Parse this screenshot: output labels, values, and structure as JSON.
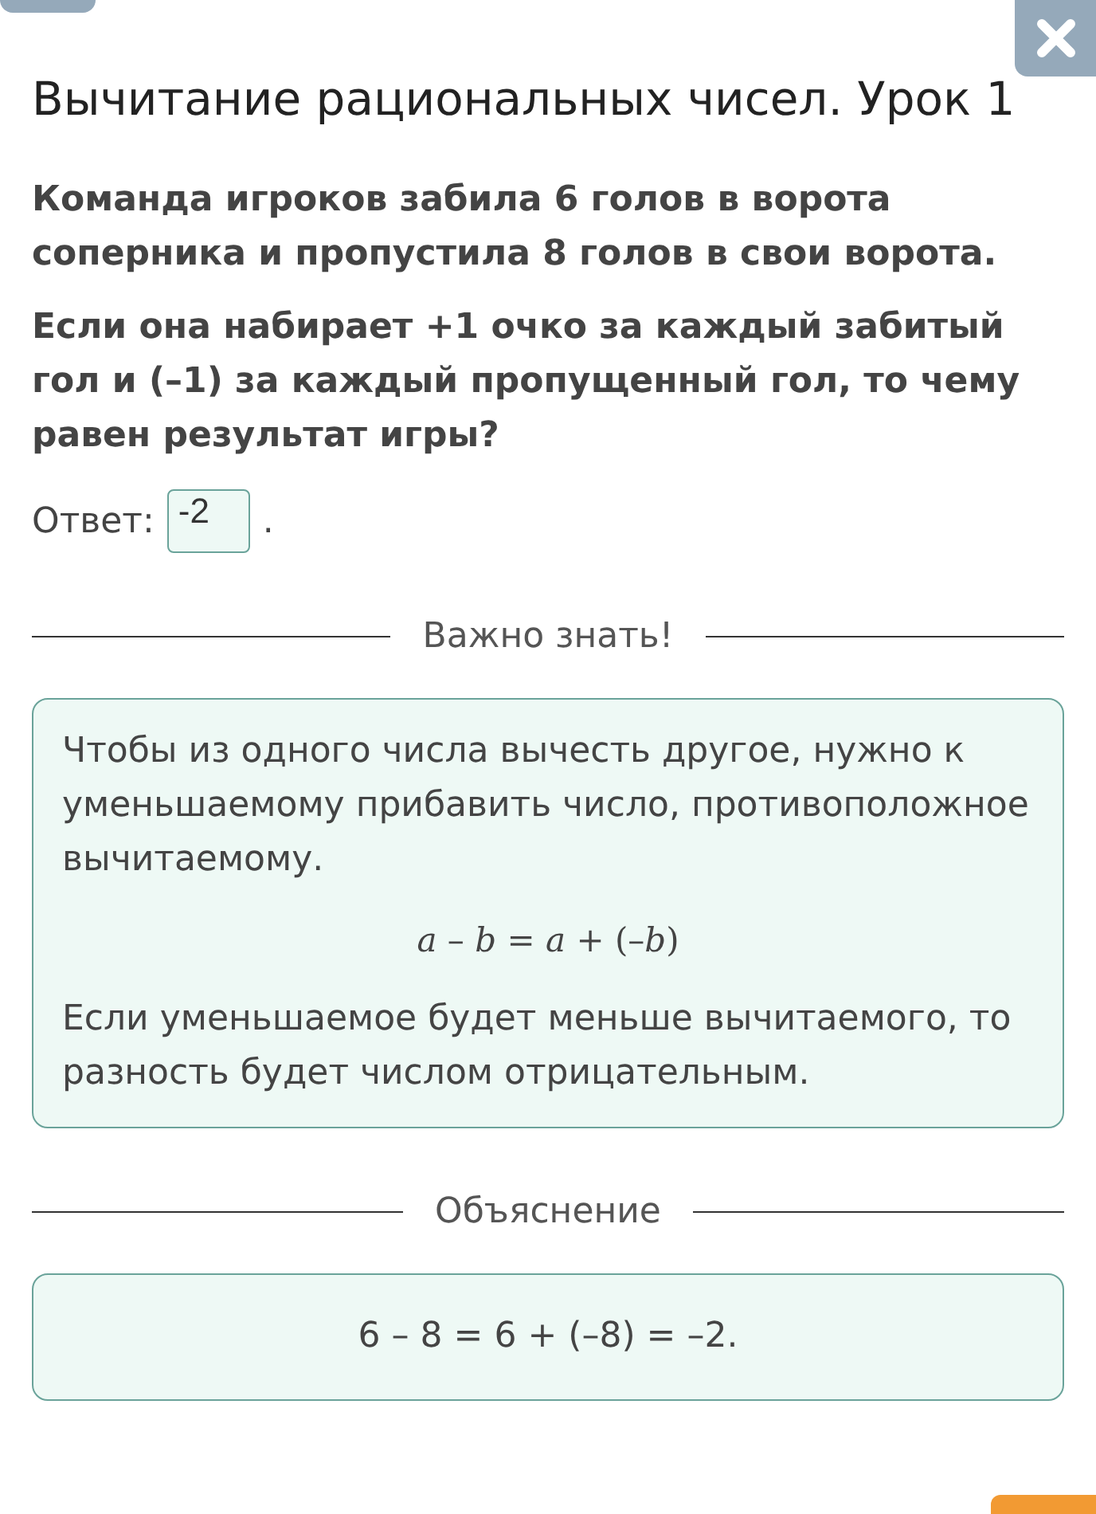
{
  "title": "Вычитание рациональных чисел. Урок 1",
  "question": [
    "Команда игроков забила 6 голов в ворота соперника и пропустила 8 голов в свои ворота.",
    "Если она набирает +1 очко за каждый забитый гол и (–1) за каждый пропущенный гол, то чему равен результат игры?"
  ],
  "answer": {
    "label": "Ответ:",
    "value": "-2",
    "suffix": "."
  },
  "important": {
    "heading": "Важно знать!",
    "paragraphs": [
      "Чтобы из одного числа вычесть другое, нужно к уменьшаемому прибавить число, противоположное вычитаемому."
    ],
    "formula": "*a* – *b* = *a* + (–*b*)",
    "note": "Если уменьшаемое будет меньше вычитаемого, то разность будет числом отрицательным."
  },
  "explanation": {
    "heading": "Объяснение",
    "text": "6 – 8 = 6 + (–8) = –2."
  }
}
